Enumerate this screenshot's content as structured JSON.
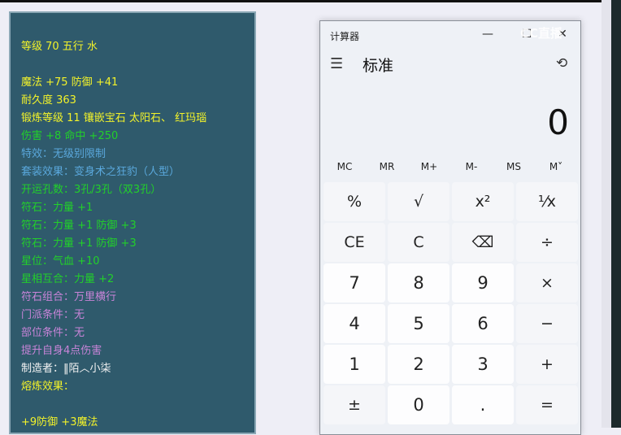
{
  "item_panel": {
    "lines": [
      "等级 70 五行 水",
      "魔法 +75 防御 +41",
      "耐久度 363",
      "锻炼等级 11 镶嵌宝石 太阳石、 红玛瑙",
      "伤害 +8 命中 +250",
      "特效：无级别限制",
      "套装效果：变身术之狂豹（人型）",
      "开运孔数：3孔/3孔（双3孔）",
      "符石：力量 +1",
      "符石：力量 +1 防御 +3",
      "符石：力量 +1 防御 +3",
      "星位：气血 +10",
      "星相互合：力量 +2",
      "符石组合：万里横行",
      "门派条件：无",
      "部位条件：无",
      "提升自身4点伤害",
      "制造者：‖陌︿小柒",
      "熔炼效果：",
      "+9防御 +3魔法"
    ]
  },
  "calculator": {
    "window_title": "计算器",
    "minimize": "—",
    "maximize": "☐",
    "close": "✕",
    "mode": "标准",
    "display": "0",
    "memory": [
      "MC",
      "MR",
      "M+",
      "M-",
      "MS",
      "M˅"
    ],
    "keys": [
      "%",
      "√",
      "x²",
      "¹⁄x",
      "CE",
      "C",
      "⌫",
      "÷",
      "7",
      "8",
      "9",
      "×",
      "4",
      "5",
      "6",
      "−",
      "1",
      "2",
      "3",
      "+",
      "±",
      "0",
      ".",
      "="
    ]
  },
  "watermark": "CC直播"
}
